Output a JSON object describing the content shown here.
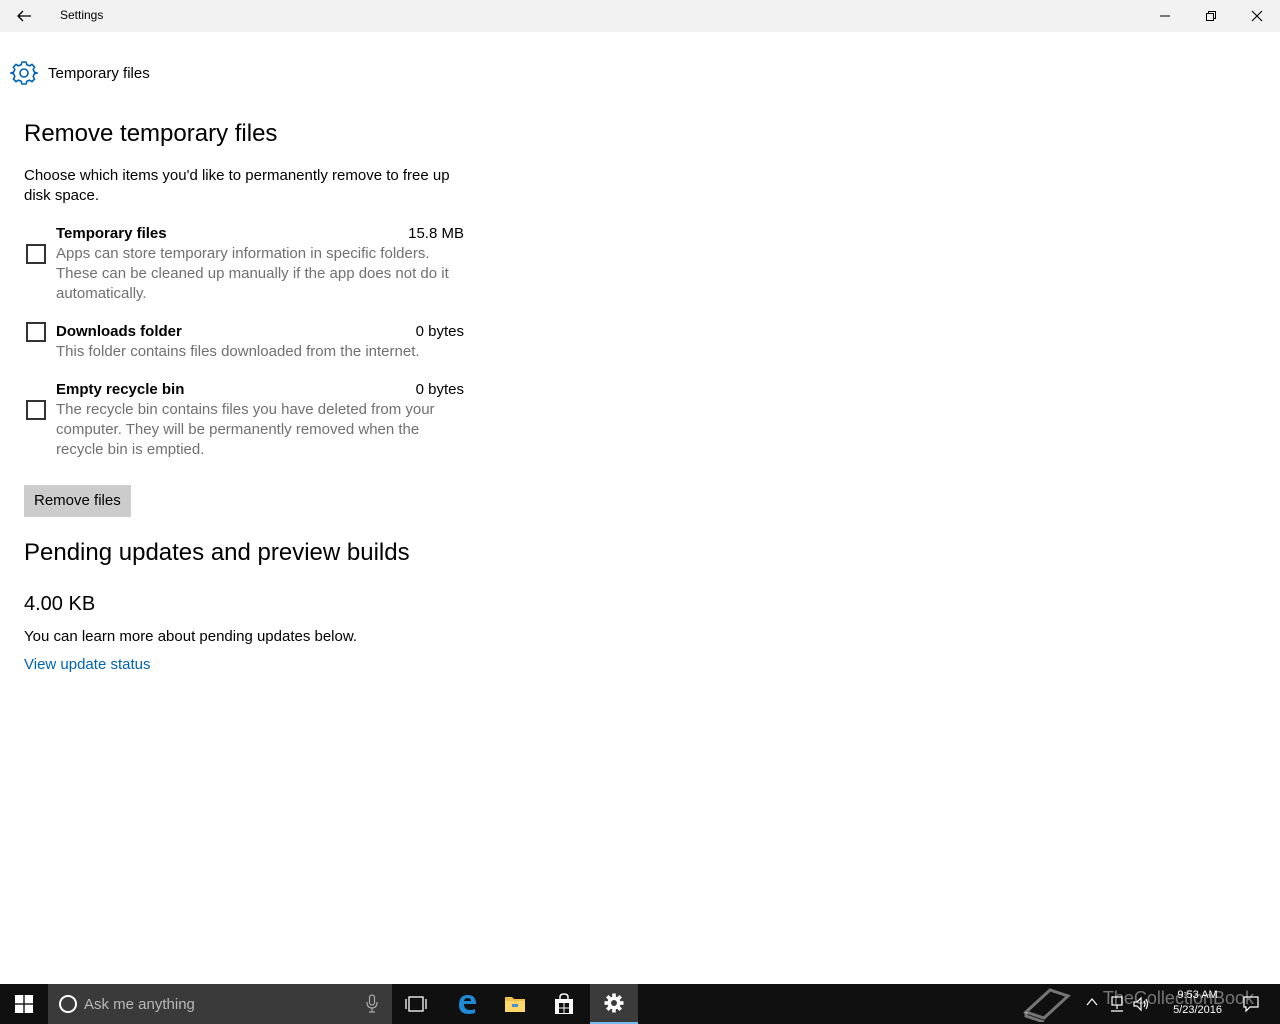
{
  "window": {
    "title": "Settings"
  },
  "header": {
    "title": "Temporary files"
  },
  "remove_section": {
    "title": "Remove temporary files",
    "description": "Choose which items you'd like to permanently remove to free up disk space.",
    "items": [
      {
        "name": "Temporary files",
        "size": "15.8 MB",
        "description": "Apps can store temporary information in specific folders. These can be cleaned up manually if the app does not do it automatically.",
        "checked": false
      },
      {
        "name": "Downloads folder",
        "size": "0 bytes",
        "description": "This folder contains files downloaded from the internet.",
        "checked": false
      },
      {
        "name": "Empty recycle bin",
        "size": "0 bytes",
        "description": "The recycle bin contains files you have deleted from your computer. They will be permanently removed when the recycle bin is emptied.",
        "checked": false
      }
    ],
    "button_label": "Remove files"
  },
  "pending_section": {
    "title": "Pending updates and preview builds",
    "size": "4.00 KB",
    "description": "You can learn more about pending updates below.",
    "link_label": "View update status"
  },
  "taskbar": {
    "search_placeholder": "Ask me anything",
    "time": "9:53 AM",
    "date": "5/23/2016",
    "watermark": "TheCollectionBook"
  },
  "colors": {
    "accent": "#0063b1",
    "titlebar": "#f2f2f2",
    "taskbar": "#101010",
    "button": "#cccccc",
    "secondary_text": "#707070"
  }
}
